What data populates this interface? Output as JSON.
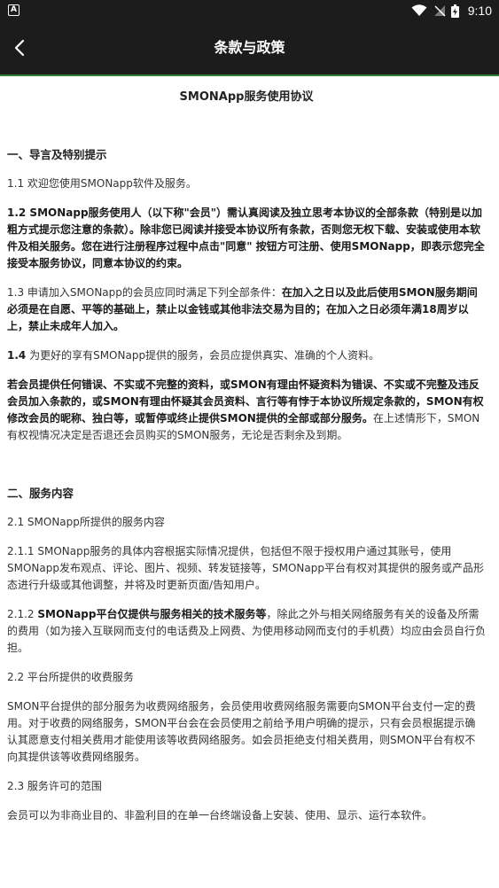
{
  "status": {
    "time": "9:10",
    "left_icon": "A"
  },
  "header": {
    "title": "条款与政策"
  },
  "doc": {
    "title": "SMONApp服务使用协议",
    "s1_heading": "一、导言及特别提示",
    "p1_1": "1.1 欢迎您使用SMONapp软件及服务。",
    "p1_2": "1.2 SMONapp服务使用人（以下称\"会员\"）需认真阅读及独立思考本协议的全部条款（特别是以加粗方式提示您注意的条款）。除非您已阅读并接受本协议所有条款，否则您无权下载、安装或使用本软件及相关服务。您在进行注册程序过程中点击\"同意\" 按钮方可注册、使用SMONapp，即表示您完全接受本服务协议，同意本协议的约束。",
    "p1_3_normal": "1.3 申请加入SMONapp的会员应同时满足下列全部条件：",
    "p1_3_bold": "在加入之日以及此后使用SMON服务期间必须是在自愿、平等的基础上，禁止以金钱或其他非法交易为目的；在加入之日必须年满18周岁以上，禁止未成年人加入。",
    "p1_4_num": "1.4",
    "p1_4_text": " 为更好的享有SMONapp提供的服务，会员应提供真实、准确的个人资料。",
    "p1_5_bold": "若会员提供任何错误、不实或不完整的资料，或SMON有理由怀疑资料为错误、不实或不完整及违反会员加入条款的，或SMON有理由怀疑其会员资料、言行等有悖于本协议所规定条款的，SMON有权修改会员的昵称、独白等，或暂停或终止提供SMON提供的全部或部分服务。",
    "p1_5_normal": "在上述情形下，SMON有权视情况决定是否退还会员购买的SMON服务，无论是否剩余及到期。",
    "s2_heading": "二、服务内容",
    "p2_1": "2.1 SMONapp所提供的服务内容",
    "p2_1_1": "2.1.1 SMONapp服务的具体内容根据实际情况提供，包括但不限于授权用户通过其账号，使用SMONapp发布观点、评论、图片、视频、转发链接等，SMONapp平台有权对其提供的服务或产品形态进行升级或其他调整，并将及时更新页面/告知用户。",
    "p2_1_2_num": "2.1.2 ",
    "p2_1_2_bold": "SMONapp平台仅提供与服务相关的技术服务等",
    "p2_1_2_normal": "，除此之外与相关网络服务有关的设备及所需的费用（如为接入互联网而支付的电话费及上网费、为使用移动网而支付的手机费）均应由会员自行负担。",
    "p2_2": "2.2 平台所提供的收费服务",
    "p2_2_text": "SMON平台提供的部分服务为收费网络服务，会员使用收费网络服务需要向SMON平台支付一定的费用。对于收费的网络服务，SMON平台会在会员使用之前给予用户明确的提示，只有会员根据提示确认其愿意支付相关费用才能使用该等收费网络服务。如会员拒绝支付相关费用，则SMON平台有权不向其提供该等收费网络服务。",
    "p2_3": "2.3 服务许可的范围",
    "p2_3_text": "会员可以为非商业目的、非盈利目的在单一台终端设备上安装、使用、显示、运行本软件。"
  }
}
